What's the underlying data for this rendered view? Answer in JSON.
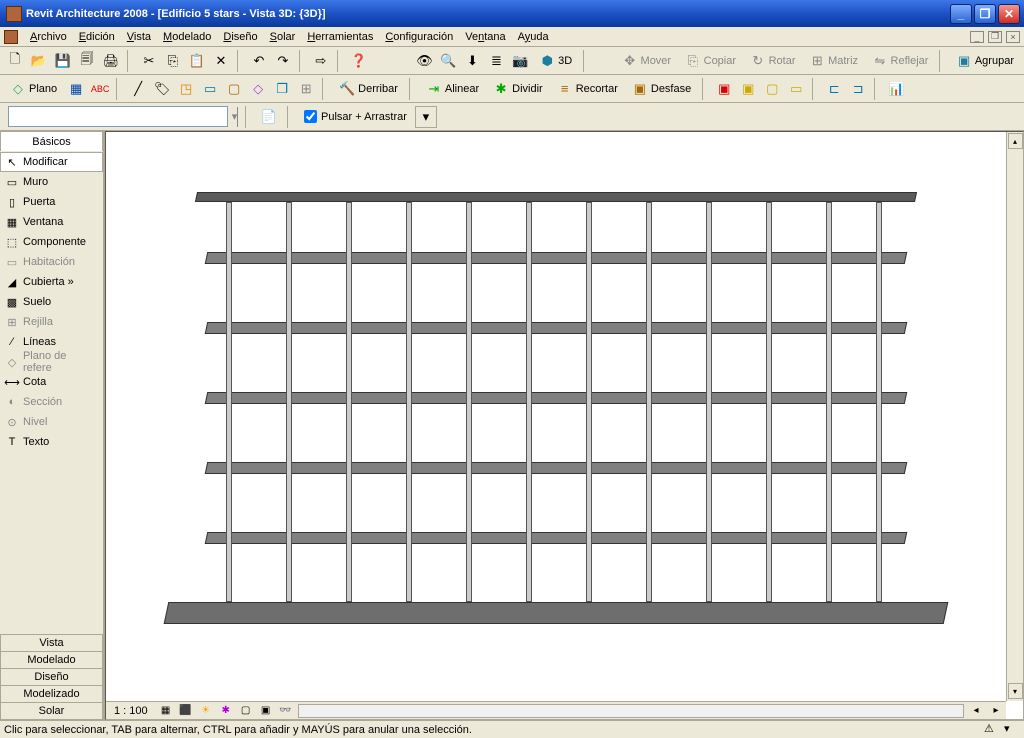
{
  "titlebar": {
    "title": "Revit Architecture 2008 - [Edificio 5 stars - Vista 3D: {3D}]"
  },
  "menubar": {
    "items": [
      {
        "label": "Archivo",
        "u": "A"
      },
      {
        "label": "Edición",
        "u": "E"
      },
      {
        "label": "Vista",
        "u": "V"
      },
      {
        "label": "Modelado",
        "u": "M"
      },
      {
        "label": "Diseño",
        "u": "D"
      },
      {
        "label": "Solar",
        "u": "S"
      },
      {
        "label": "Herramientas",
        "u": "H"
      },
      {
        "label": "Configuración",
        "u": "C"
      },
      {
        "label": "Ventana",
        "u": "n"
      },
      {
        "label": "Ayuda",
        "u": "y"
      }
    ]
  },
  "toolbar1": {
    "view3d_label": "3D",
    "mover": "Mover",
    "copiar": "Copiar",
    "rotar": "Rotar",
    "matriz": "Matriz",
    "reflejar": "Reflejar",
    "agrupar": "Agrupar"
  },
  "toolbar2": {
    "plano": "Plano",
    "derribar": "Derribar",
    "alinear": "Alinear",
    "dividir": "Dividir",
    "recortar": "Recortar",
    "desfase": "Desfase"
  },
  "toolbar3": {
    "checkbox_label": "Pulsar + Arrastrar"
  },
  "sidebar": {
    "top_tab": "Básicos",
    "items": [
      {
        "icon": "↖",
        "label": "Modificar",
        "active": true,
        "disabled": false,
        "name": "modificar"
      },
      {
        "icon": "▭",
        "label": "Muro",
        "active": false,
        "disabled": false,
        "name": "muro"
      },
      {
        "icon": "▯",
        "label": "Puerta",
        "active": false,
        "disabled": false,
        "name": "puerta"
      },
      {
        "icon": "▦",
        "label": "Ventana",
        "active": false,
        "disabled": false,
        "name": "ventana"
      },
      {
        "icon": "⬚",
        "label": "Componente",
        "active": false,
        "disabled": false,
        "name": "componente"
      },
      {
        "icon": "▭",
        "label": "Habitación",
        "active": false,
        "disabled": true,
        "name": "habitacion"
      },
      {
        "icon": "◢",
        "label": "Cubierta »",
        "active": false,
        "disabled": false,
        "name": "cubierta"
      },
      {
        "icon": "▩",
        "label": "Suelo",
        "active": false,
        "disabled": false,
        "name": "suelo"
      },
      {
        "icon": "⊞",
        "label": "Rejilla",
        "active": false,
        "disabled": true,
        "name": "rejilla"
      },
      {
        "icon": "⁄",
        "label": "Líneas",
        "active": false,
        "disabled": false,
        "name": "lineas"
      },
      {
        "icon": "◇",
        "label": "Plano de refere",
        "active": false,
        "disabled": true,
        "name": "plano-referencia"
      },
      {
        "icon": "⟷",
        "label": "Cota",
        "active": false,
        "disabled": false,
        "name": "cota"
      },
      {
        "icon": "◐",
        "label": "Sección",
        "active": false,
        "disabled": true,
        "name": "seccion"
      },
      {
        "icon": "⊙",
        "label": "Nivel",
        "active": false,
        "disabled": true,
        "name": "nivel"
      },
      {
        "icon": "T",
        "label": "Texto",
        "active": false,
        "disabled": false,
        "name": "texto"
      }
    ],
    "bottom_tabs": [
      "Vista",
      "Modelado",
      "Diseño",
      "Modelizado",
      "Solar"
    ]
  },
  "hscroll": {
    "scale": "1 : 100"
  },
  "statusbar": {
    "text": "Clic para seleccionar, TAB para alternar, CTRL para añadir y MAYÚS para anular una selección."
  }
}
